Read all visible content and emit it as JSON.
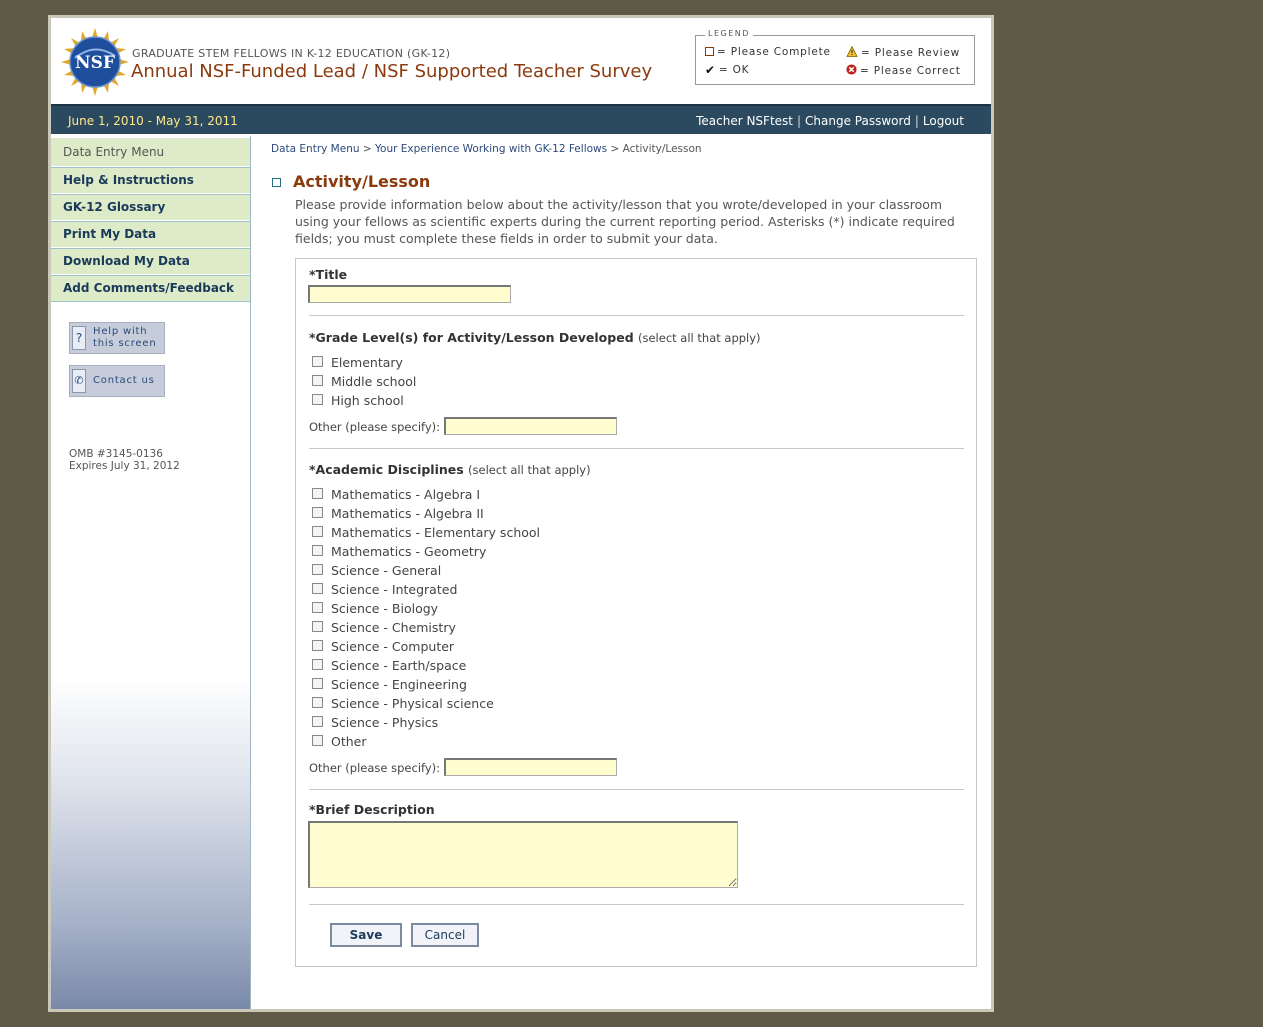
{
  "header": {
    "subtitle": "GRADUATE STEM FELLOWS IN K-12 EDUCATION (GK-12)",
    "title": "Annual NSF-Funded Lead / NSF Supported Teacher Survey",
    "logo_text": "NSF",
    "legend": {
      "title": "LEGEND",
      "please_complete": "= Please Complete",
      "please_review": "= Please Review",
      "ok": "= OK",
      "please_correct": "= Please Correct"
    }
  },
  "navbar": {
    "dates": "June 1, 2010 - May 31, 2011",
    "teacher": "Teacher NSFtest",
    "change_password": "Change Password",
    "logout": "Logout",
    "separator": "|"
  },
  "sidebar": {
    "menu_head": "Data Entry Menu",
    "items": [
      {
        "label": "Help & Instructions"
      },
      {
        "label": "GK-12 Glossary"
      },
      {
        "label": "Print My Data"
      },
      {
        "label": "Download My Data"
      },
      {
        "label": "Add Comments/Feedback"
      }
    ],
    "help_line1": "Help with",
    "help_line2": "this screen",
    "contact": "Contact us",
    "omb_line1": "OMB #3145-0136",
    "omb_line2": "Expires July 31, 2012"
  },
  "breadcrumb": {
    "item1": "Data Entry Menu",
    "item2": "Your Experience Working with GK-12 Fellows",
    "current": "Activity/Lesson",
    "sep": ">"
  },
  "main": {
    "heading": "Activity/Lesson",
    "intro": "Please provide information below about the activity/lesson that you wrote/developed in your classroom using your fellows as scientific experts during the current reporting period. Asterisks (*) indicate required fields; you must complete these fields in order to submit your data."
  },
  "form": {
    "title_label": "*Title",
    "title_value": "",
    "grade_label": "*Grade Level(s) for Activity/Lesson Developed",
    "select_all_hint": "(select all that apply)",
    "grades": [
      "Elementary",
      "Middle school",
      "High school"
    ],
    "other_label": "Other (please specify):",
    "grade_other_value": "",
    "disciplines_label": "*Academic Disciplines",
    "disciplines": [
      "Mathematics - Algebra I",
      "Mathematics - Algebra II",
      "Mathematics - Elementary school",
      "Mathematics - Geometry",
      "Science - General",
      "Science - Integrated",
      "Science - Biology",
      "Science - Chemistry",
      "Science - Computer",
      "Science - Earth/space",
      "Science - Engineering",
      "Science - Physical science",
      "Science - Physics",
      "Other"
    ],
    "discipline_other_value": "",
    "description_label": "*Brief Description",
    "description_value": "",
    "save_label": "Save",
    "cancel_label": "Cancel"
  },
  "colors": {
    "background": "#5f5a45",
    "navbar": "#2c4a5f",
    "accent_title": "#8b3a0e",
    "menu_bg": "#deebc9",
    "input_bg": "#fffdd0"
  }
}
